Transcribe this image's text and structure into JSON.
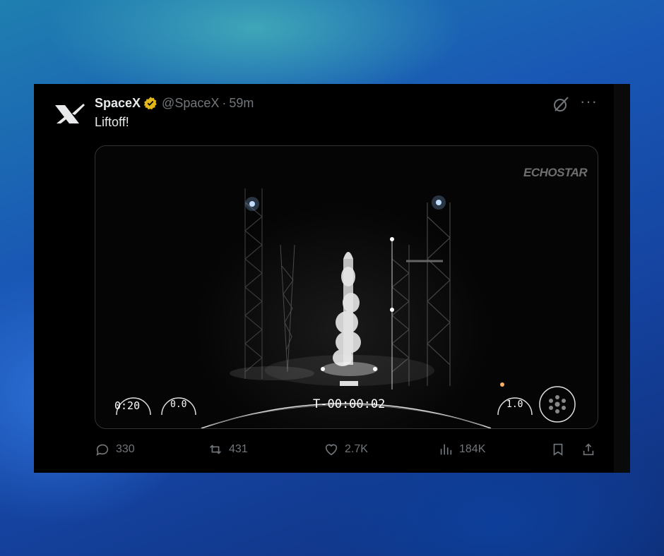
{
  "tweet": {
    "author_name": "SpaceX",
    "handle": "@SpaceX",
    "separator": "·",
    "time": "59m",
    "text": "Liftoff!",
    "more_label": "···"
  },
  "media": {
    "watermark": "ECHOSTAR",
    "stage1_speed": "0:20",
    "stage1_altitude": "0.0",
    "stage2_speed": "1.0",
    "countdown": "T-00:00:02"
  },
  "actions": {
    "replies": "330",
    "reposts": "431",
    "likes": "2.7K",
    "views": "184K"
  },
  "colors": {
    "muted": "#71767b",
    "verified": "#e2b719",
    "card_bg": "#000000",
    "text": "#e7e9ea"
  },
  "icons": [
    "spacex-logo-icon",
    "verified-badge-icon",
    "grok-icon",
    "more-icon",
    "reply-icon",
    "repost-icon",
    "like-icon",
    "views-icon",
    "bookmark-icon",
    "share-icon"
  ]
}
